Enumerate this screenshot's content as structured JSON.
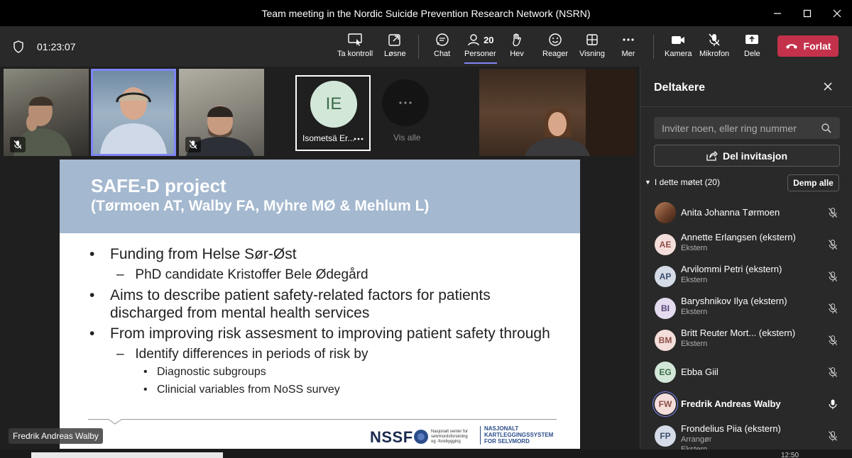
{
  "window": {
    "title": "Team meeting in the Nordic Suicide Prevention Research Network (NSRN)",
    "controls": [
      "minimize",
      "maximize",
      "close"
    ]
  },
  "toolbar": {
    "timer": "01:23:07",
    "take_control": "Ta kontroll",
    "popout": "Løsne",
    "chat": "Chat",
    "people": "Personer",
    "people_count": "20",
    "raise_hand": "Hev",
    "react": "Reager",
    "view": "Visning",
    "more": "Mer",
    "camera": "Kamera",
    "mic": "Mikrofon",
    "share": "Dele",
    "leave": "Forlat",
    "colors": {
      "leave": "#c4314b",
      "active_underline": "#7f85f5"
    }
  },
  "videos": {
    "tile_initials": "IE",
    "tile_name": "Isometsä Er...",
    "see_all": "Vis alle"
  },
  "slide": {
    "title": "SAFE-D project",
    "subtitle": "(Tørmoen AT, Walby FA, Myhre MØ & Mehlum L)",
    "bullets": [
      {
        "text": "Funding from Helse Sør-Øst"
      },
      {
        "text": "PhD candidate Kristoffer Bele Ødegård"
      },
      {
        "text": "Aims to describe patient safety-related factors for patients"
      },
      {
        "text": "discharged from mental health services"
      },
      {
        "text": "From improving risk assesment to improving patient safety through"
      },
      {
        "text": "Identify differences in periods of risk by"
      },
      {
        "text": "Diagnostic subgroups"
      },
      {
        "text": "Clinicial variables from NoSS survey"
      }
    ],
    "logo_nssf": "NSSF",
    "logo_nssf_small": [
      "Nasjonalt senter for",
      "selvmordsforskning",
      "og -forebygging"
    ],
    "logo_nks": [
      "NASJONALT",
      "KARTLEGGINGSSYSTEM",
      "FOR SELVMORD"
    ],
    "presenter_tag": "Fredrik Andreas Walby",
    "header_color": "#a4b8cf"
  },
  "panel": {
    "title": "Deltakere",
    "invite_placeholder": "Inviter noen, eller ring nummer",
    "share_invite": "Del invitasjon",
    "section": "I dette møtet (20)",
    "mute_all": "Demp alle",
    "participants": [
      {
        "initials": "",
        "name": "Anita Johanna Tørmoen",
        "sub": "",
        "mic": "muted"
      },
      {
        "initials": "AE",
        "name": "Annette Erlangsen (ekstern)",
        "sub": "Ekstern",
        "mic": "muted"
      },
      {
        "initials": "AP",
        "name": "Arvilommi Petri (ekstern)",
        "sub": "Ekstern",
        "mic": "muted"
      },
      {
        "initials": "BI",
        "name": "Baryshnikov Ilya (ekstern)",
        "sub": "Ekstern",
        "mic": "muted"
      },
      {
        "initials": "BM",
        "name": "Britt Reuter Mort... (ekstern)",
        "sub": "Ekstern",
        "mic": "muted"
      },
      {
        "initials": "EG",
        "name": "Ebba Giil",
        "sub": "",
        "mic": "muted"
      },
      {
        "initials": "FW",
        "name": "Fredrik Andreas Walby",
        "sub": "",
        "mic": "on"
      },
      {
        "initials": "FP",
        "name": "Frondelius Piia (ekstern)",
        "sub": "Arrangør",
        "sub2": "Ekstern",
        "mic": "muted"
      }
    ]
  },
  "taskbar": {
    "clock": "12:50"
  }
}
